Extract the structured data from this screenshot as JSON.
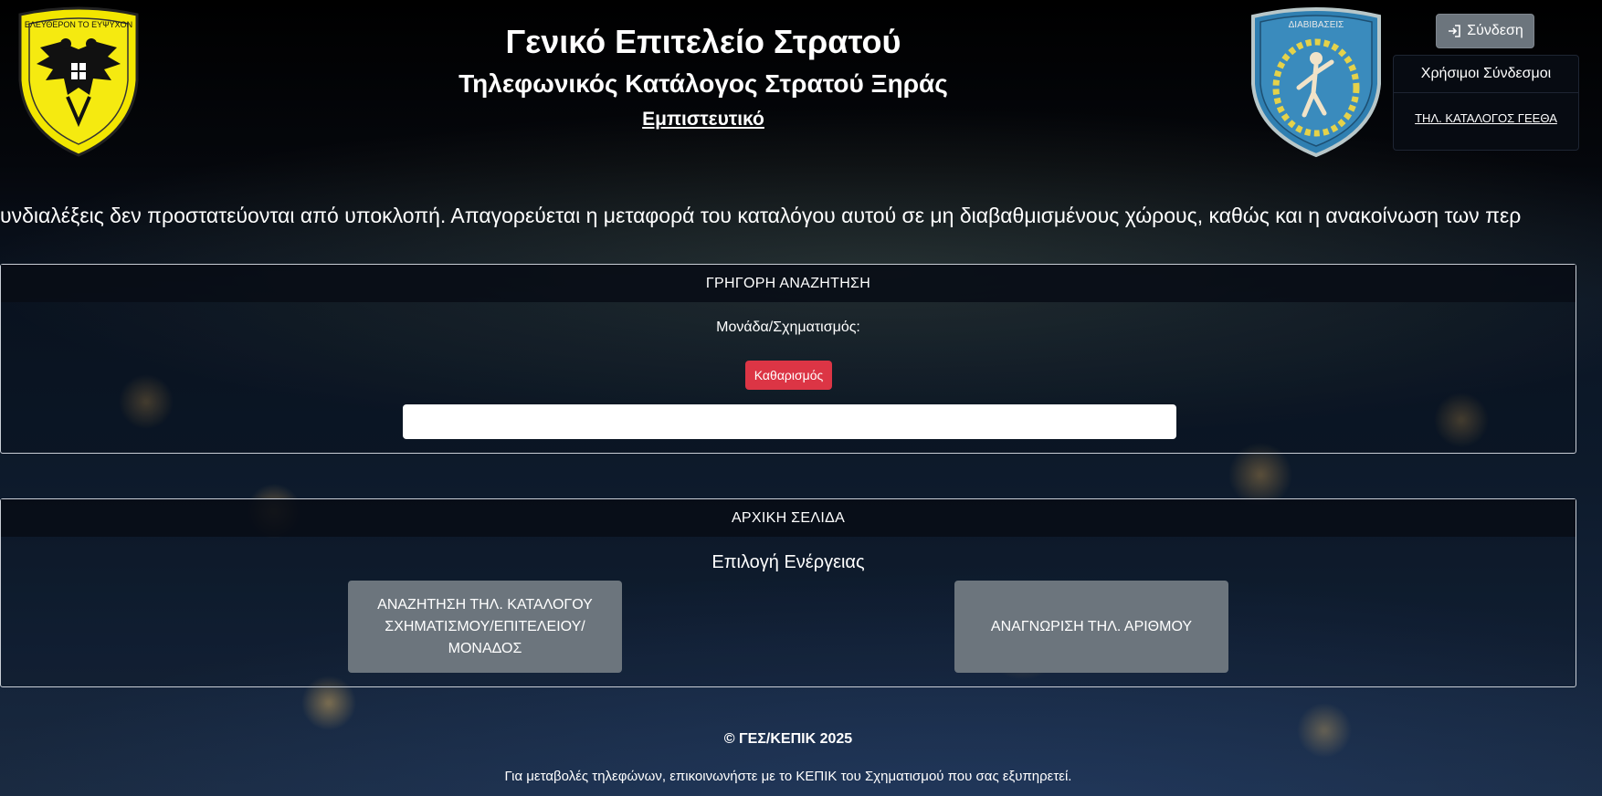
{
  "header": {
    "title": "Γενικό Επιτελείο Στρατού",
    "subtitle": "Τηλεφωνικός Κατάλογος Στρατού Ξηράς",
    "classification": "Εμπιστευτικό"
  },
  "logos": {
    "left_text": "ΕΛΕΥΘΕΡΟΝ ΤΟ ΕΥΨΥΧΟΝ",
    "right_text": "ΔΙΑΒΙΒΑΣΕΙΣ"
  },
  "login": {
    "label": "Σύνδεση",
    "icon": "login-icon"
  },
  "useful_links": {
    "title": "Χρήσιμοι Σύνδεσμοι",
    "items": [
      {
        "label": "ΤΗΛ. ΚΑΤΑΛΟΓΟΣ ΓΕΕΘΑ"
      }
    ]
  },
  "marquee": {
    "text": "υνδιαλέξεις δεν προστατεύονται από υποκλοπή. Απαγορεύεται η μεταφορά του καταλόγου αυτού σε μη διαβαθμισμένους χώρους, καθώς και η ανακοίνωση των περ"
  },
  "quick_search": {
    "header": "ΓΡΗΓΟΡΗ ΑΝΑΖΗΤΗΣΗ",
    "unit_label": "Μονάδα/Σχηματισμός:",
    "clear_label": "Καθαρισμός",
    "input_value": ""
  },
  "home": {
    "header": "ΑΡΧΙΚΗ ΣΕΛΙΔΑ",
    "action_title": "Επιλογή Ενέργειας",
    "btn_directory": "ΑΝΑΖΗΤΗΣΗ ΤΗΛ. ΚΑΤΑΛΟΓΟΥ ΣΧΗΜΑΤΙΣΜΟΥ/ΕΠΙΤΕΛΕΙΟΥ/ ΜΟΝΑΔΟΣ",
    "btn_identify": "ΑΝΑΓΝΩΡΙΣΗ ΤΗΛ. ΑΡΙΘΜΟΥ"
  },
  "footer": {
    "copyright": "© ΓΕΣ/ΚΕΠΙΚ 2025",
    "note": "Για μεταβολές τηλεφώνων, επικοινωνήστε με το ΚΕΠΙΚ του Σχηματισμού που σας εξυπηρετεί."
  },
  "colors": {
    "clear_button": "#dc3545",
    "action_button": "#6c757d",
    "logo_left_yellow": "#f2e600",
    "logo_right_blue": "#2f7fb1"
  }
}
